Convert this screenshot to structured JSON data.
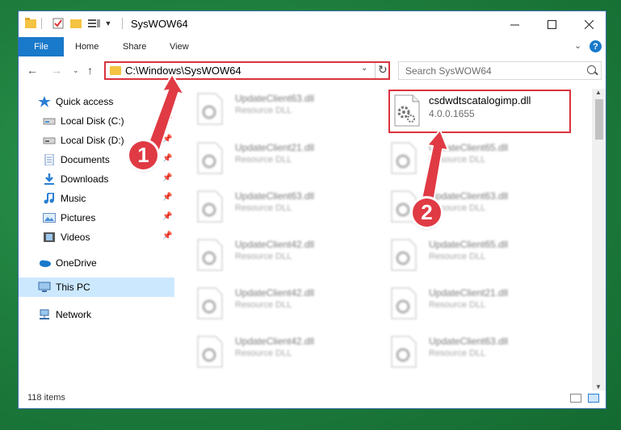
{
  "window": {
    "title": "SysWOW64"
  },
  "ribbon": {
    "tabs": [
      "File",
      "Home",
      "Share",
      "View"
    ]
  },
  "address": {
    "path": "C:\\Windows\\SysWOW64"
  },
  "search": {
    "placeholder": "Search SysWOW64"
  },
  "sidebar": {
    "quick_access": "Quick access",
    "items": [
      {
        "label": "Local Disk (C:)",
        "icon": "drive-icon"
      },
      {
        "label": "Local Disk (D:)",
        "icon": "drive-icon"
      },
      {
        "label": "Documents",
        "icon": "documents-icon"
      },
      {
        "label": "Downloads",
        "icon": "downloads-icon"
      },
      {
        "label": "Music",
        "icon": "music-icon"
      },
      {
        "label": "Pictures",
        "icon": "pictures-icon"
      },
      {
        "label": "Videos",
        "icon": "videos-icon"
      }
    ],
    "onedrive": "OneDrive",
    "this_pc": "This PC",
    "network": "Network"
  },
  "files": {
    "highlighted": {
      "name": "csdwdtscatalogimp.dll",
      "version": "4.0.0.1655"
    },
    "blurred_left": [
      {
        "name": "UpdateClient63.dll",
        "type": "Resource DLL"
      },
      {
        "name": "UpdateClient21.dll",
        "type": "Resource DLL"
      },
      {
        "name": "UpdateClient63.dll",
        "type": "Resource DLL"
      },
      {
        "name": "UpdateClient42.dll",
        "type": "Resource DLL"
      },
      {
        "name": "UpdateClient42.dll",
        "type": "Resource DLL"
      },
      {
        "name": "UpdateClient42.dll",
        "type": "Resource DLL"
      }
    ],
    "blurred_right": [
      {
        "name": "UpdateClient65.dll",
        "type": "Resource DLL"
      },
      {
        "name": "UpdateClient63.dll",
        "type": "Resource DLL"
      },
      {
        "name": "UpdateClient65.dll",
        "type": "Resource DLL"
      },
      {
        "name": "UpdateClient21.dll",
        "type": "Resource DLL"
      },
      {
        "name": "UpdateClient63.dll",
        "type": "Resource DLL"
      }
    ]
  },
  "status": {
    "items": "118 items"
  },
  "callouts": {
    "one": "1",
    "two": "2"
  },
  "colors": {
    "accent": "#1979ca",
    "highlight_red": "#d9333f",
    "callout_red": "#e03a44"
  }
}
